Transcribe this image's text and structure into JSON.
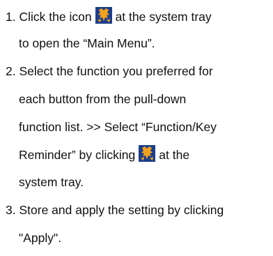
{
  "steps": [
    {
      "number": "1.",
      "line1_before_icon": "Click the icon",
      "line1_after_icon": "at the system tray",
      "line2": "to open the “Main Menu”."
    },
    {
      "number": "2.",
      "line1": "Select the function you preferred for",
      "line2": "each button from the pull-down",
      "line3": "function list. >> Select “Function/Key",
      "line4_before_icon": "Reminder” by clicking",
      "line4_after_icon": "at the",
      "line5": "system tray."
    },
    {
      "number": "3.",
      "line1": "Store and apply the setting by clicking",
      "line2": "\"Apply\"."
    }
  ],
  "icon": {
    "name": "system-tray-app-icon",
    "colors": {
      "background": "#1c3f8a",
      "glyph": "#f4a21c"
    }
  }
}
